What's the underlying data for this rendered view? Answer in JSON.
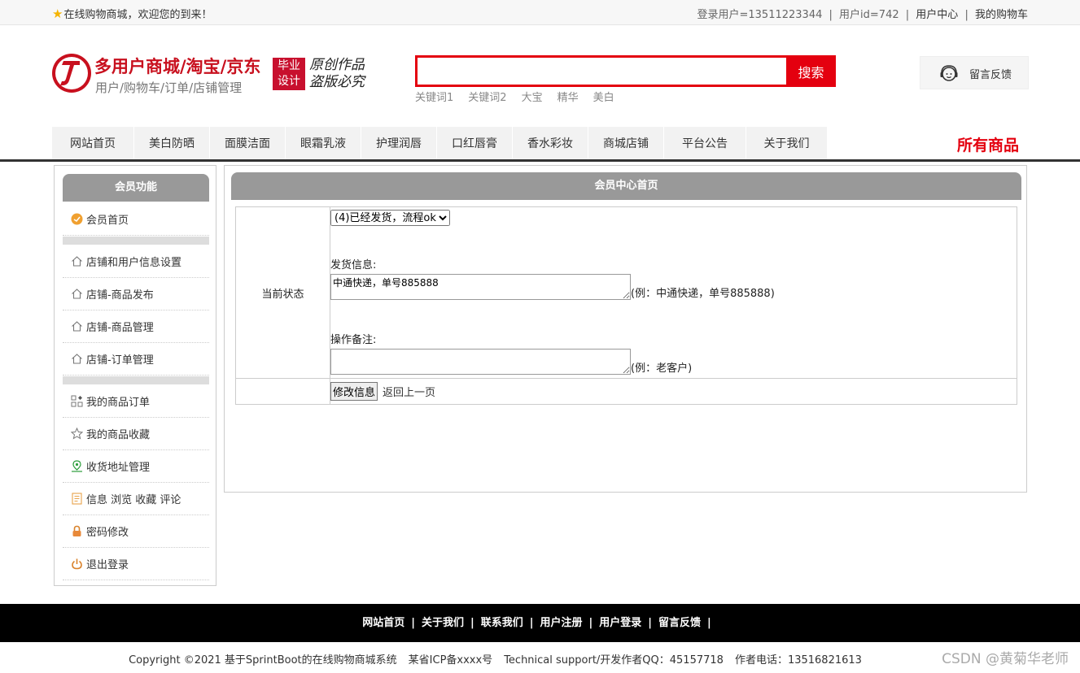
{
  "topbar": {
    "welcome": "在线购物商城，欢迎您的到来！",
    "login_user": "登录用户=13511223344",
    "user_id": "用户id=742",
    "user_center": "用户中心",
    "cart": "我的购物车",
    "separator": "|"
  },
  "header": {
    "brand_title": "多用户商城/淘宝/京东",
    "brand_subtitle": "用户/购物车/订单/店铺管理",
    "badge_line1": "毕业",
    "badge_line2": "设计",
    "slogan_line1": "原创作品",
    "slogan_line2": "盗版必究",
    "search_value": "",
    "search_button": "搜索",
    "hot_keywords": [
      "关键词1",
      "关键词2",
      "大宝",
      "精华",
      "美白"
    ],
    "feedback": "留言反馈"
  },
  "nav": {
    "items": [
      "网站首页",
      "美白防晒",
      "面膜洁面",
      "眼霜乳液",
      "护理润唇",
      "口红唇膏",
      "香水彩妆",
      "商城店铺",
      "平台公告",
      "关于我们"
    ],
    "all_goods": "所有商品"
  },
  "sidebar": {
    "title": "会员功能",
    "home": "会员首页",
    "shop_items": [
      "店铺和用户信息设置",
      "店铺-商品发布",
      "店铺-商品管理",
      "店铺-订单管理"
    ],
    "user_items": [
      "我的商品订单",
      "我的商品收藏",
      "收货地址管理",
      "信息 浏览 收藏 评论",
      "密码修改",
      "退出登录"
    ]
  },
  "main": {
    "title": "会员中心首页",
    "status_label": "当前状态",
    "status_selected": "(4)已经发货，流程ok",
    "shipping_label": "发货信息:",
    "shipping_value": "中通快递，单号885888",
    "shipping_hint": "(例：中通快递，单号885888)",
    "remark_label": "操作备注:",
    "remark_value": "",
    "remark_hint": "(例：老客户)",
    "modify_button": "修改信息",
    "back_link": "返回上一页"
  },
  "footer": {
    "links": [
      "网站首页",
      "关于我们",
      "联系我们",
      "用户注册",
      "用户登录",
      "留言反馈"
    ],
    "separator": "|",
    "copyright": "Copyright ©2021 基于SprintBoot的在线购物商城系统",
    "icp": "某省ICP备xxxx号",
    "support": "Technical support/开发作者QQ：45157718",
    "phone": "作者电话：13516821613",
    "watermark": "CSDN @黄菊华老师"
  },
  "colors": {
    "brand_red": "#c8101e",
    "search_red": "#e4000f",
    "panel_gray": "#999999"
  }
}
